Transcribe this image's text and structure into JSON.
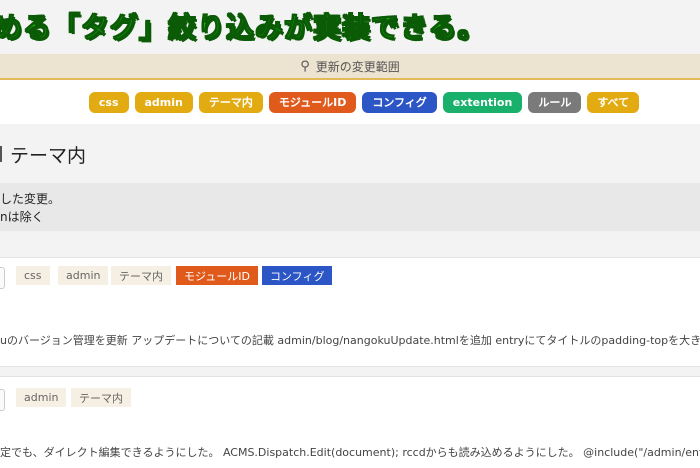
{
  "headline": "める「タグ」絞り込みが実装できる。",
  "filter_bar": {
    "label": "更新の変更範囲"
  },
  "tags": [
    {
      "label": "css",
      "color": "#e3ab12"
    },
    {
      "label": "admin",
      "color": "#e3ab12"
    },
    {
      "label": "テーマ内",
      "color": "#e3ab12"
    },
    {
      "label": "モジュールID",
      "color": "#e05a1c"
    },
    {
      "label": "コンフィグ",
      "color": "#2c55c5"
    },
    {
      "label": "extention",
      "color": "#18b06a"
    },
    {
      "label": "ルール",
      "color": "#7a7a7a"
    },
    {
      "label": "すべて",
      "color": "#e3ab12"
    }
  ],
  "section": {
    "title": "テーマ内"
  },
  "description": {
    "line1": "した変更。",
    "line2": "nは除く"
  },
  "cards": [
    {
      "tags": [
        {
          "label": "css",
          "style": "light"
        },
        {
          "label": "admin",
          "style": "light"
        },
        {
          "label": "テーマ内",
          "style": "light"
        },
        {
          "label": "モジュールID",
          "style": "solid",
          "color": "#e05a1c"
        },
        {
          "label": "コンフィグ",
          "style": "solid",
          "color": "#2c55c5"
        }
      ],
      "body": "uのバージョン管理を更新 アップデートについての記載 admin/blog/nangokuUpdate.htmlを追加 entryにてタイトルのpadding-topを大きく"
    },
    {
      "tags": [
        {
          "label": "admin",
          "style": "light"
        },
        {
          "label": "テーマ内",
          "style": "light"
        }
      ],
      "body": "定でも、ダイレクト編集できるようにした。 ACMS.Dispatch.Edit(document); rccdからも読み込めるようにした。 @include(\"/admin/entry"
    }
  ]
}
